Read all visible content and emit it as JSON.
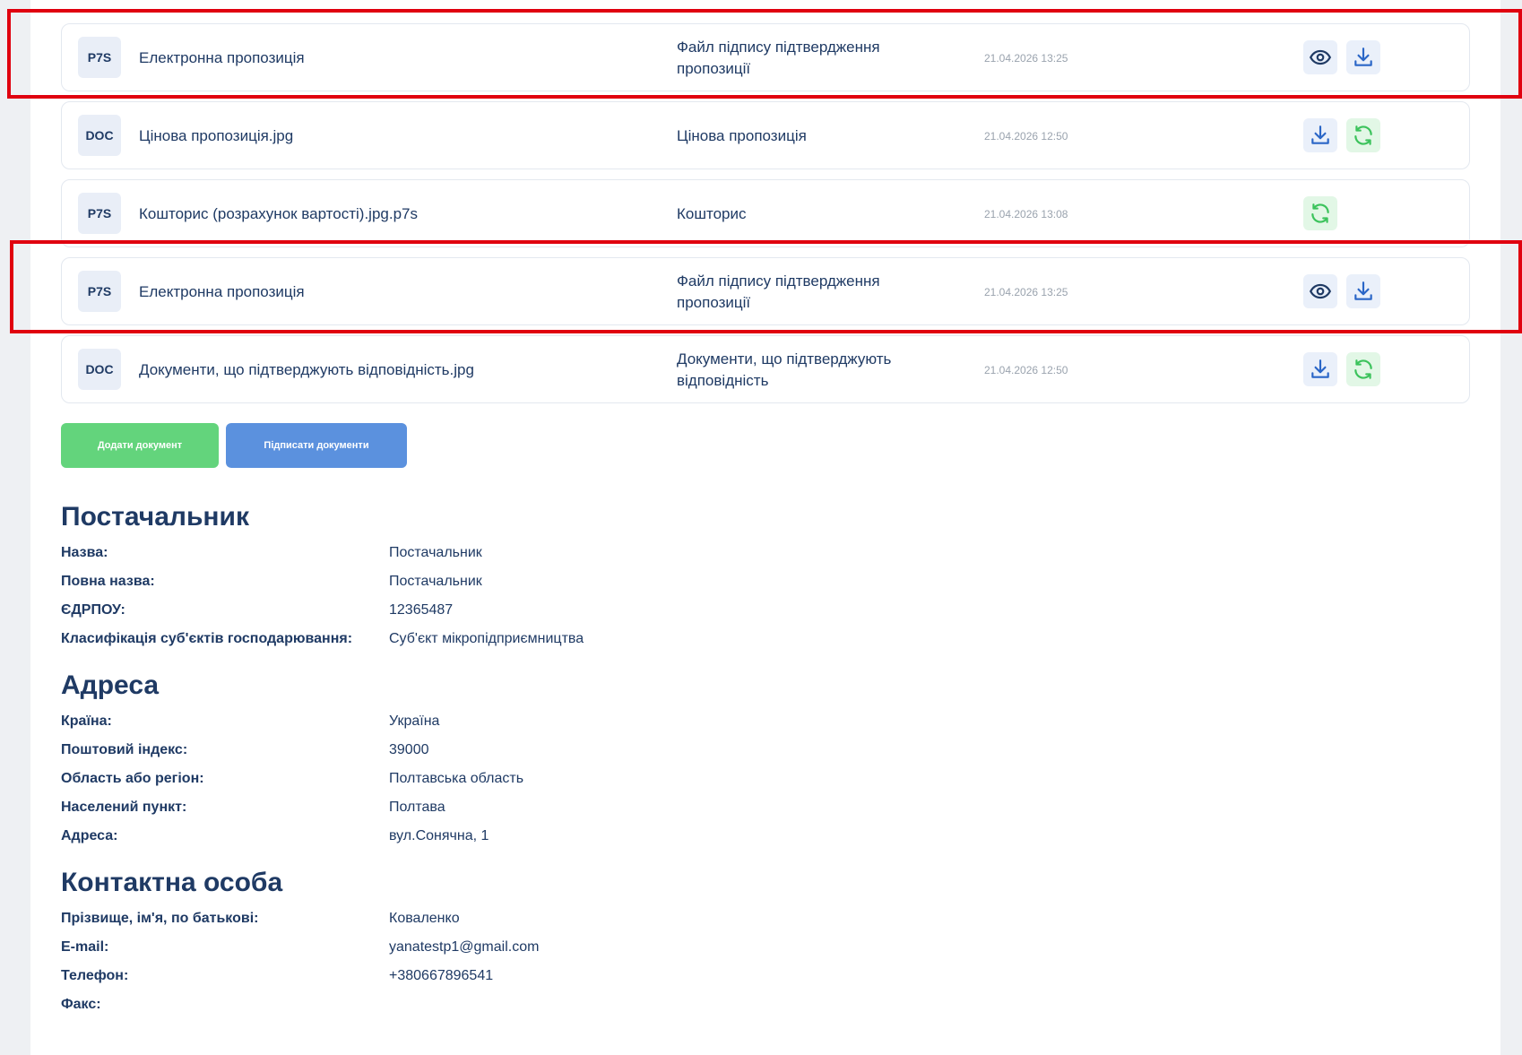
{
  "documents": [
    {
      "badge": "P7S",
      "name": "Електронна пропозиція",
      "type": "Файл підпису підтвердження пропозиції",
      "date": "21.04.2026 13:25",
      "actions": [
        "eye-icon",
        "download-icon"
      ]
    },
    {
      "badge": "DOC",
      "name": "Цінова пропозиція.jpg",
      "type": "Цінова пропозиція",
      "date": "21.04.2026 12:50",
      "actions": [
        "download-icon",
        "refresh-icon"
      ]
    },
    {
      "badge": "P7S",
      "name": "Кошторис (розрахунок вартості).jpg.p7s",
      "type": "Кошторис",
      "date": "21.04.2026 13:08",
      "actions": [
        "refresh-icon"
      ]
    },
    {
      "badge": "P7S",
      "name": "Електронна пропозиція",
      "type": "Файл підпису підтвердження пропозиції",
      "date": "21.04.2026 13:25",
      "actions": [
        "eye-icon",
        "download-icon"
      ]
    },
    {
      "badge": "DOC",
      "name": "Документи, що підтверджують відповідність.jpg",
      "type": "Документи, що підтверджують відповідність",
      "date": "21.04.2026 12:50",
      "actions": [
        "download-icon",
        "refresh-icon"
      ]
    }
  ],
  "buttons": {
    "add": "Додати документ",
    "sign": "Підписати документи"
  },
  "supplier": {
    "title": "Постачальник",
    "rows": [
      {
        "label": "Назва:",
        "value": "Постачальник"
      },
      {
        "label": "Повна назва:",
        "value": "Постачальник"
      },
      {
        "label": "ЄДРПОУ:",
        "value": "12365487"
      },
      {
        "label": "Класифікація суб'єктів господарювання:",
        "value": "Суб'єкт мікропідприємництва"
      }
    ]
  },
  "address": {
    "title": "Адреса",
    "rows": [
      {
        "label": "Країна:",
        "value": "Україна"
      },
      {
        "label": "Поштовий індекс:",
        "value": "39000"
      },
      {
        "label": "Область або регіон:",
        "value": "Полтавська область"
      },
      {
        "label": "Населений пункт:",
        "value": "Полтава"
      },
      {
        "label": "Адреса:",
        "value": "вул.Сонячна, 1"
      }
    ]
  },
  "contact": {
    "title": "Контактна особа",
    "rows": [
      {
        "label": "Прізвище, ім'я, по батькові:",
        "value": "Коваленко"
      },
      {
        "label": "E-mail:",
        "value": "yanatestp1@gmail.com"
      },
      {
        "label": "Телефон:",
        "value": "+380667896541"
      },
      {
        "label": "Факс:",
        "value": ""
      }
    ]
  },
  "colors": {
    "highlight": "#e0000f",
    "add_button": "#63d47c",
    "sign_button": "#5b91de",
    "text": "#1f3a64"
  }
}
